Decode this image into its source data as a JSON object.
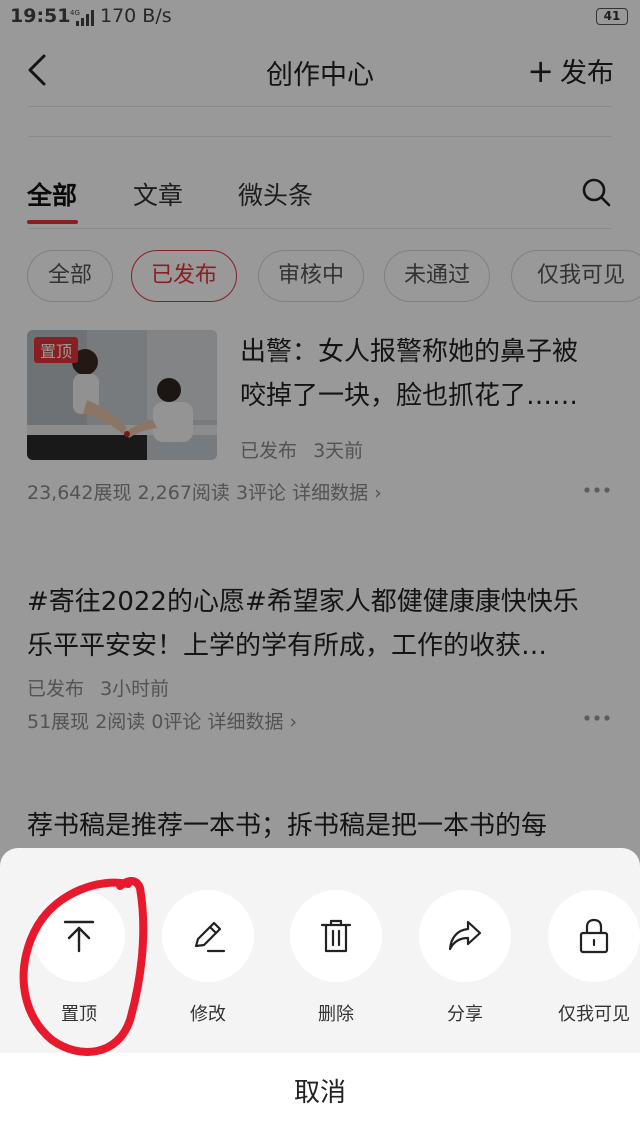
{
  "status_bar": {
    "time": "19:51",
    "network": "4G",
    "speed": "170 B/s",
    "battery": "41"
  },
  "nav": {
    "title": "创作中心",
    "publish": "发布"
  },
  "tabs": [
    "全部",
    "文章",
    "微头条"
  ],
  "filters": [
    "全部",
    "已发布",
    "审核中",
    "未通过",
    "仅我可见"
  ],
  "articles": [
    {
      "badge": "置顶",
      "title_lines": [
        "出警：女人报警称她的鼻子被",
        "咬掉了一块，脸也抓花了……"
      ],
      "status": "已发布",
      "time": "3天前",
      "stats": "23,642展现  2,267阅读  3评论  详细数据 ›"
    },
    {
      "title_lines": [
        "#寄往2022的心愿#希望家人都健健康康快快乐",
        "乐平平安安！上学的学有所成，工作的收获…"
      ],
      "status": "已发布",
      "time": "3小时前",
      "stats": "51展现  2阅读  0评论  详细数据 ›"
    },
    {
      "title_lines": [
        "荐书稿是推荐一本书；拆书稿是把一本书的每"
      ]
    }
  ],
  "actions": [
    {
      "label": "置顶",
      "icon": "pin-top-icon"
    },
    {
      "label": "修改",
      "icon": "pencil-icon"
    },
    {
      "label": "删除",
      "icon": "trash-icon"
    },
    {
      "label": "分享",
      "icon": "share-arrow-icon"
    },
    {
      "label": "仅我可见",
      "icon": "lock-icon"
    }
  ],
  "cancel": "取消",
  "colors": {
    "accent": "#e5343a",
    "annotation": "#e8192c",
    "sheet_bg": "#f4f4f4"
  }
}
